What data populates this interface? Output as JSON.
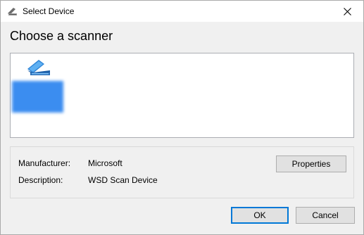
{
  "window": {
    "title": "Select Device"
  },
  "heading": "Choose a scanner",
  "devices": [
    {
      "name": "",
      "icon": "scanner-icon",
      "selected": true
    }
  ],
  "details": {
    "manufacturer_label": "Manufacturer:",
    "manufacturer_value": "Microsoft",
    "description_label": "Description:",
    "description_value": "WSD Scan Device"
  },
  "buttons": {
    "properties": "Properties",
    "ok": "OK",
    "cancel": "Cancel"
  },
  "colors": {
    "selection": "#3b8df0",
    "default_button_border": "#0078d7",
    "dialog_background": "#f0f0f0"
  }
}
